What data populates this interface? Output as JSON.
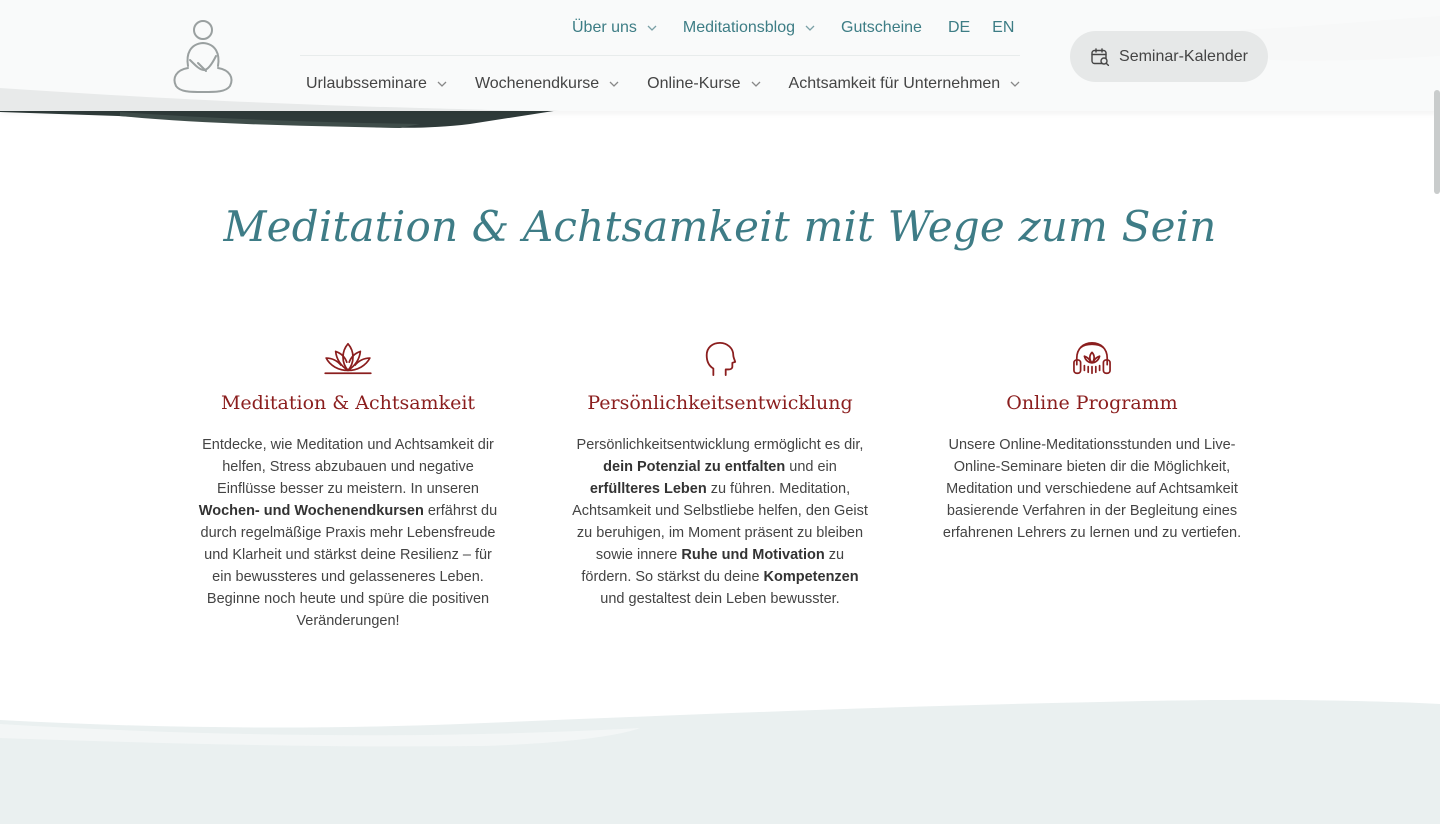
{
  "header": {
    "top_nav": [
      {
        "label": "Über uns",
        "has_dropdown": true
      },
      {
        "label": "Meditationsblog",
        "has_dropdown": true
      },
      {
        "label": "Gutscheine",
        "has_dropdown": false
      }
    ],
    "languages": [
      "DE",
      "EN"
    ],
    "main_nav": [
      {
        "label": "Urlaubsseminare",
        "has_dropdown": true
      },
      {
        "label": "Wochenendkurse",
        "has_dropdown": true
      },
      {
        "label": "Online-Kurse",
        "has_dropdown": true
      },
      {
        "label": "Achtsamkeit für Unternehmen",
        "has_dropdown": true
      }
    ],
    "seminar_button": {
      "label": "Seminar-Kalender",
      "icon": "calendar-search-icon"
    }
  },
  "main": {
    "title": "Meditation & Achtsamkeit mit Wege zum Sein",
    "features": [
      {
        "icon": "lotus-icon",
        "title": "Meditation & Achtsamkeit",
        "text": [
          "Entdecke, wie Meditation und Achtsamkeit dir helfen, Stress abzubauen und negative Einflüsse besser zu meistern. In unseren ",
          {
            "bold": "Wochen- und Wochenendkursen"
          },
          " erfährst du durch regelmäßige Praxis mehr Lebensfreude und Klarheit und stärkst deine Resilienz – für ein bewussteres und gelasseneres Leben. Beginne noch heute und spüre die positiven Veränderungen!"
        ]
      },
      {
        "icon": "head-profile-icon",
        "title": "Persönlichkeitsentwicklung",
        "text": [
          "Persönlichkeitsentwicklung ermöglicht es dir, ",
          {
            "bold": "dein Potenzial zu entfalten"
          },
          " und ein ",
          {
            "bold": "erfüllteres Leben"
          },
          " zu führen. Meditation, Achtsamkeit und Selbstliebe helfen, den Geist zu beruhigen, im Moment präsent zu bleiben sowie innere ",
          {
            "bold": "Ruhe und Motivation"
          },
          " zu fördern. So stärkst du deine ",
          {
            "bold": "Kompetenzen"
          },
          " und gestaltest dein Leben bewusster."
        ]
      },
      {
        "icon": "headphones-lotus-icon",
        "title": "Online Programm",
        "text": [
          "Unsere Online-Meditationsstunden und Live-Online-Seminare bieten dir die Möglichkeit, Meditation und verschiedene auf Achtsamkeit basierende Verfahren in der Begleitung eines erfahrenen Lehrers zu lernen und zu vertiefen."
        ]
      }
    ]
  },
  "colors": {
    "teal": "#3e7c86",
    "dark_red": "#8b1e1e",
    "text": "#444444",
    "header_bg": "#f9fafa",
    "button_bg": "#e6e8e8",
    "wave": "#eaf0f0"
  }
}
